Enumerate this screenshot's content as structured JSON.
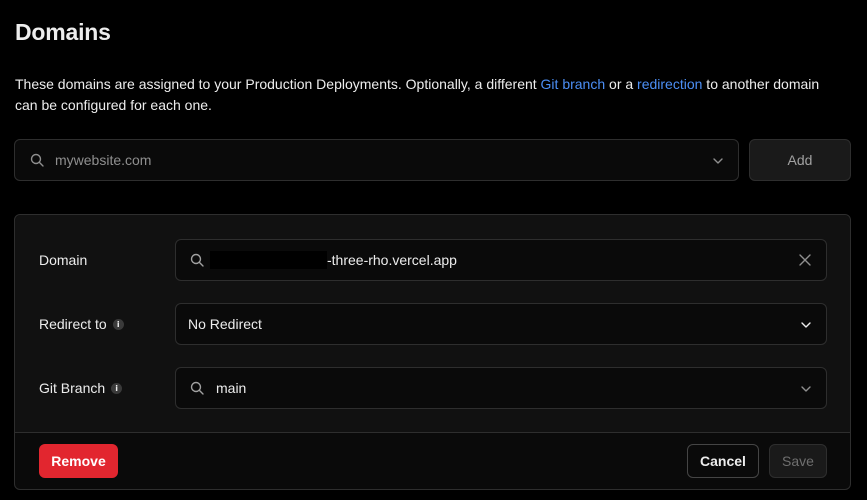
{
  "page": {
    "title": "Domains",
    "description": {
      "before": "These domains are assigned to your Production Deployments. Optionally, a different ",
      "link1": "Git branch",
      "middle": " or a ",
      "link2": "redirection",
      "after": " to another domain can be configured for each one."
    }
  },
  "add_domain": {
    "placeholder": "mywebsite.com",
    "button_label": "Add",
    "search_icon": "search-icon",
    "chevron_icon": "chevron-down-icon"
  },
  "domain_card": {
    "domain": {
      "label": "Domain",
      "value_suffix": "-three-rho.vercel.app",
      "clear_icon": "close-icon"
    },
    "redirect": {
      "label": "Redirect to",
      "value": "No Redirect",
      "info_icon": "info-icon"
    },
    "git_branch": {
      "label": "Git Branch",
      "value": "main",
      "info_icon": "info-icon"
    },
    "actions": {
      "remove_label": "Remove",
      "cancel_label": "Cancel",
      "save_label": "Save"
    }
  },
  "colors": {
    "background": "#000000",
    "link": "#4c8ff5",
    "danger": "#e2262f"
  }
}
